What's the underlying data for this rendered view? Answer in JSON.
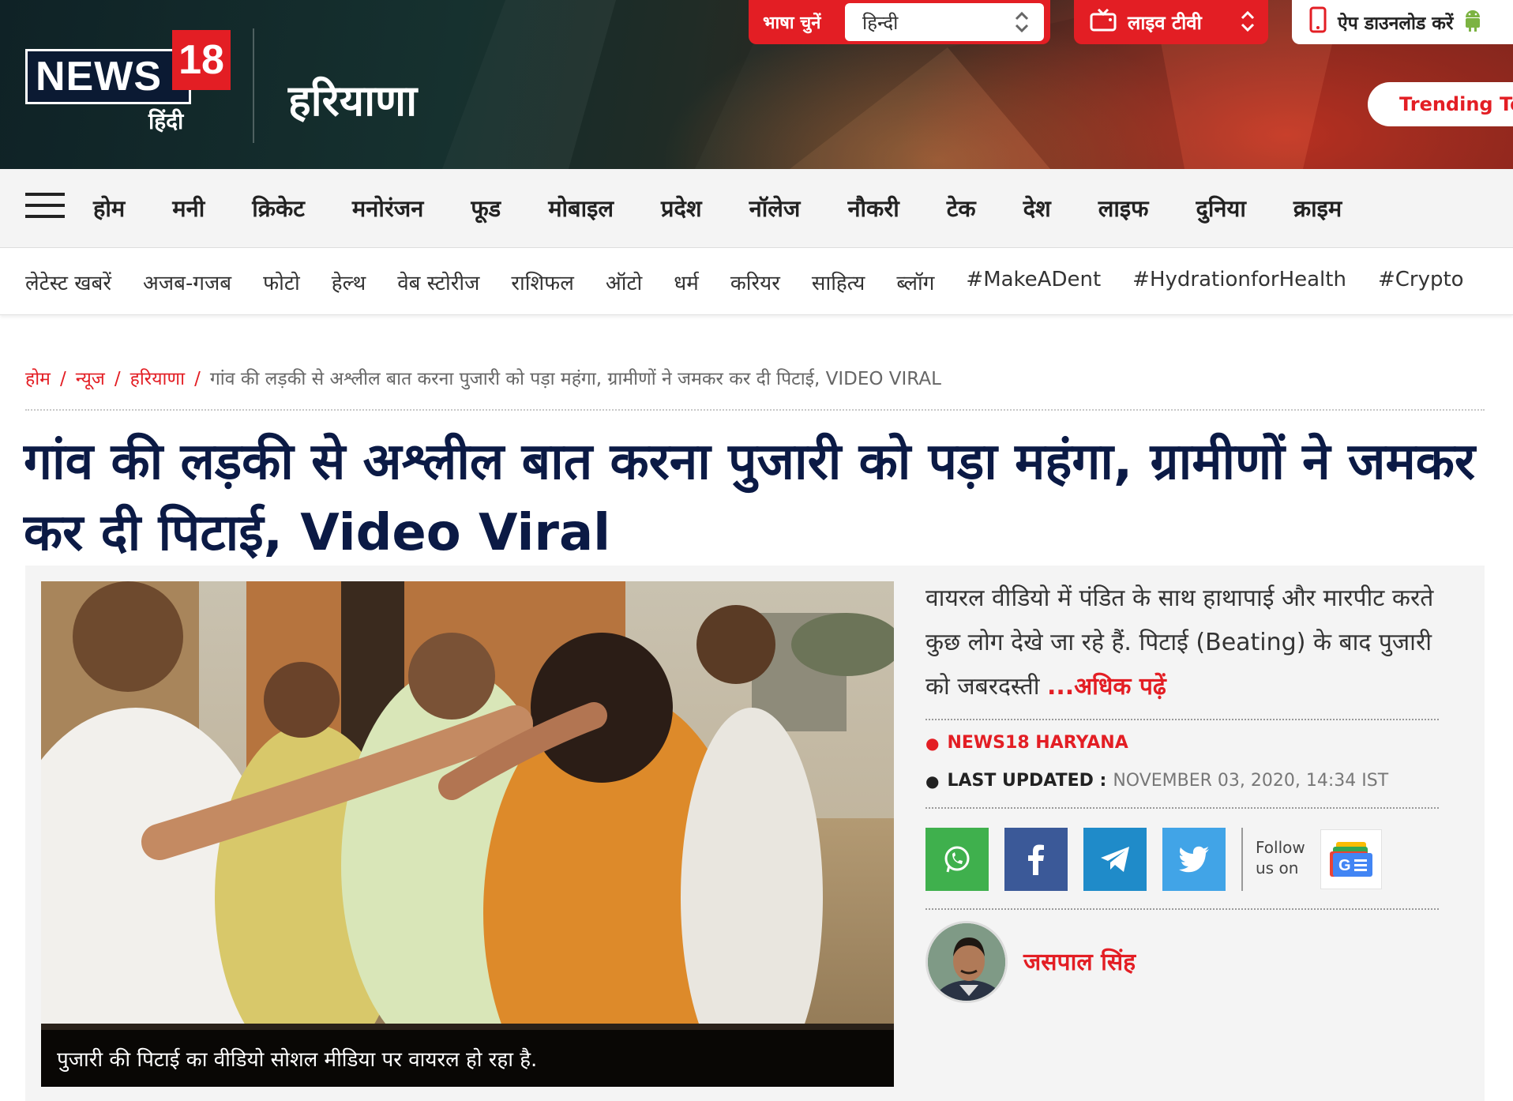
{
  "header": {
    "logo_text": "NEWS",
    "logo_number": "18",
    "logo_hindi": "हिंदी",
    "section_title": "हरियाणा",
    "language_label": "भाषा चुनें",
    "language_value": "हिन्दी",
    "live_tv_label": "लाइव टीवी",
    "app_download_label": "ऐप डाउनलोड करें",
    "trending_label": "Trending Top"
  },
  "main_nav": {
    "items": [
      "होम",
      "मनी",
      "क्रिकेट",
      "मनोरंजन",
      "फूड",
      "मोबाइल",
      "प्रदेश",
      "नॉलेज",
      "नौकरी",
      "टेक",
      "देश",
      "लाइफ",
      "दुनिया",
      "क्राइम"
    ]
  },
  "sub_nav": {
    "items": [
      "लेटेस्ट खबरें",
      "अजब-गजब",
      "फोटो",
      "हेल्थ",
      "वेब स्टोरीज",
      "राशिफल",
      "ऑटो",
      "धर्म",
      "करियर",
      "साहित्य",
      "ब्लॉग",
      "#MakeADent",
      "#HydrationforHealth",
      "#Crypto"
    ]
  },
  "breadcrumb": {
    "items": [
      "होम",
      "न्यूज",
      "हरियाणा"
    ],
    "current": "गांव की लड़की से अश्लील बात करना पुजारी को पड़ा महंगा, ग्रामीणों ने जमकर कर दी पिटाई, VIDEO VIRAL"
  },
  "article": {
    "headline": "गांव की लड़की से अश्लील बात करना पुजारी को पड़ा महंगा, ग्रामीणों ने जमकर कर दी पिटाई, Video Viral",
    "image_caption": "पुजारी की पिटाई का वीडियो सोशल मीडिया पर वायरल हो रहा है.",
    "summary": "वायरल वीडियो में पंडित के साथ हाथापाई और मारपीट करते कुछ लोग देखे जा रहे हैं. पिटाई (Beating) के बाद पुजारी को जबरदस्ती ",
    "read_more": "...अधिक पढ़ें",
    "source": "NEWS18 HARYANA",
    "last_updated_label": "LAST UPDATED :",
    "last_updated_value": "NOVEMBER 03, 2020, 14:34 IST",
    "follow_text": "Follow us on",
    "author": "जसपाल सिंह"
  },
  "colors": {
    "brand_red": "#e31e24",
    "headline_navy": "#0b1a45",
    "whatsapp": "#3fb04d",
    "facebook": "#3b5998",
    "telegram": "#1f8bc9",
    "twitter": "#41a4e7"
  },
  "icons": [
    "hamburger-icon",
    "chevron-updown-icon",
    "tv-icon",
    "phone-icon",
    "android-icon",
    "whatsapp-icon",
    "facebook-icon",
    "telegram-icon",
    "twitter-icon",
    "google-news-icon"
  ]
}
